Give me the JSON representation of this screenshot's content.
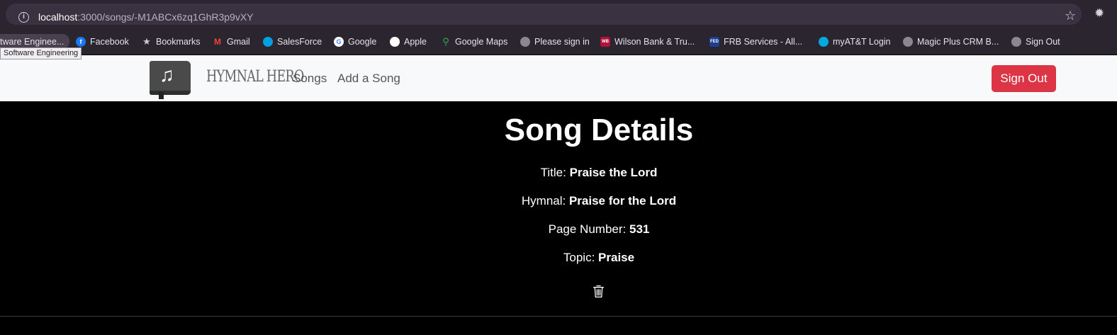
{
  "browser": {
    "url_host": "localhost",
    "url_path": ":3000/songs/-M1ABCx6zq1GhR3p9vXY",
    "tooltip": "Software Engineering",
    "bookmarks": [
      {
        "label": "tware Enginee...",
        "icon": "folder-icon"
      },
      {
        "label": "Facebook",
        "icon": "facebook-icon",
        "color": "#1877f2"
      },
      {
        "label": "Bookmarks",
        "icon": "star-icon"
      },
      {
        "label": "Gmail",
        "icon": "gmail-icon",
        "color": "#ea4335"
      },
      {
        "label": "SalesForce",
        "icon": "salesforce-icon",
        "color": "#00a1e0"
      },
      {
        "label": "Google",
        "icon": "google-icon",
        "color": "#4285f4"
      },
      {
        "label": "Apple",
        "icon": "apple-icon"
      },
      {
        "label": "Google Maps",
        "icon": "google-maps-icon",
        "color": "#34a853"
      },
      {
        "label": "Please sign in",
        "icon": "globe-icon"
      },
      {
        "label": "Wilson Bank & Tru...",
        "icon": "wilson-bank-icon",
        "color": "#b3123a"
      },
      {
        "label": "FRB Services - All...",
        "icon": "frb-icon",
        "color": "#1d3f8f"
      },
      {
        "label": "myAT&T Login",
        "icon": "att-icon",
        "color": "#00a8e0"
      },
      {
        "label": "Magic Plus CRM B...",
        "icon": "globe-icon"
      },
      {
        "label": "Sign Out",
        "icon": "globe-icon"
      }
    ]
  },
  "navbar": {
    "brand": "HYMNAL HERO",
    "links": [
      "Songs",
      "Add a Song"
    ],
    "signout_label": "Sign Out"
  },
  "song": {
    "heading": "Song Details",
    "title_label": "Title:",
    "title_value": "Praise the Lord",
    "hymnal_label": "Hymnal:",
    "hymnal_value": "Praise for the Lord",
    "page_label": "Page Number:",
    "page_value": "531",
    "topic_label": "Topic:",
    "topic_value": "Praise"
  },
  "colors": {
    "accent_danger": "#dc3545",
    "navbar_bg": "#f8f9fa",
    "content_bg": "#000000"
  }
}
